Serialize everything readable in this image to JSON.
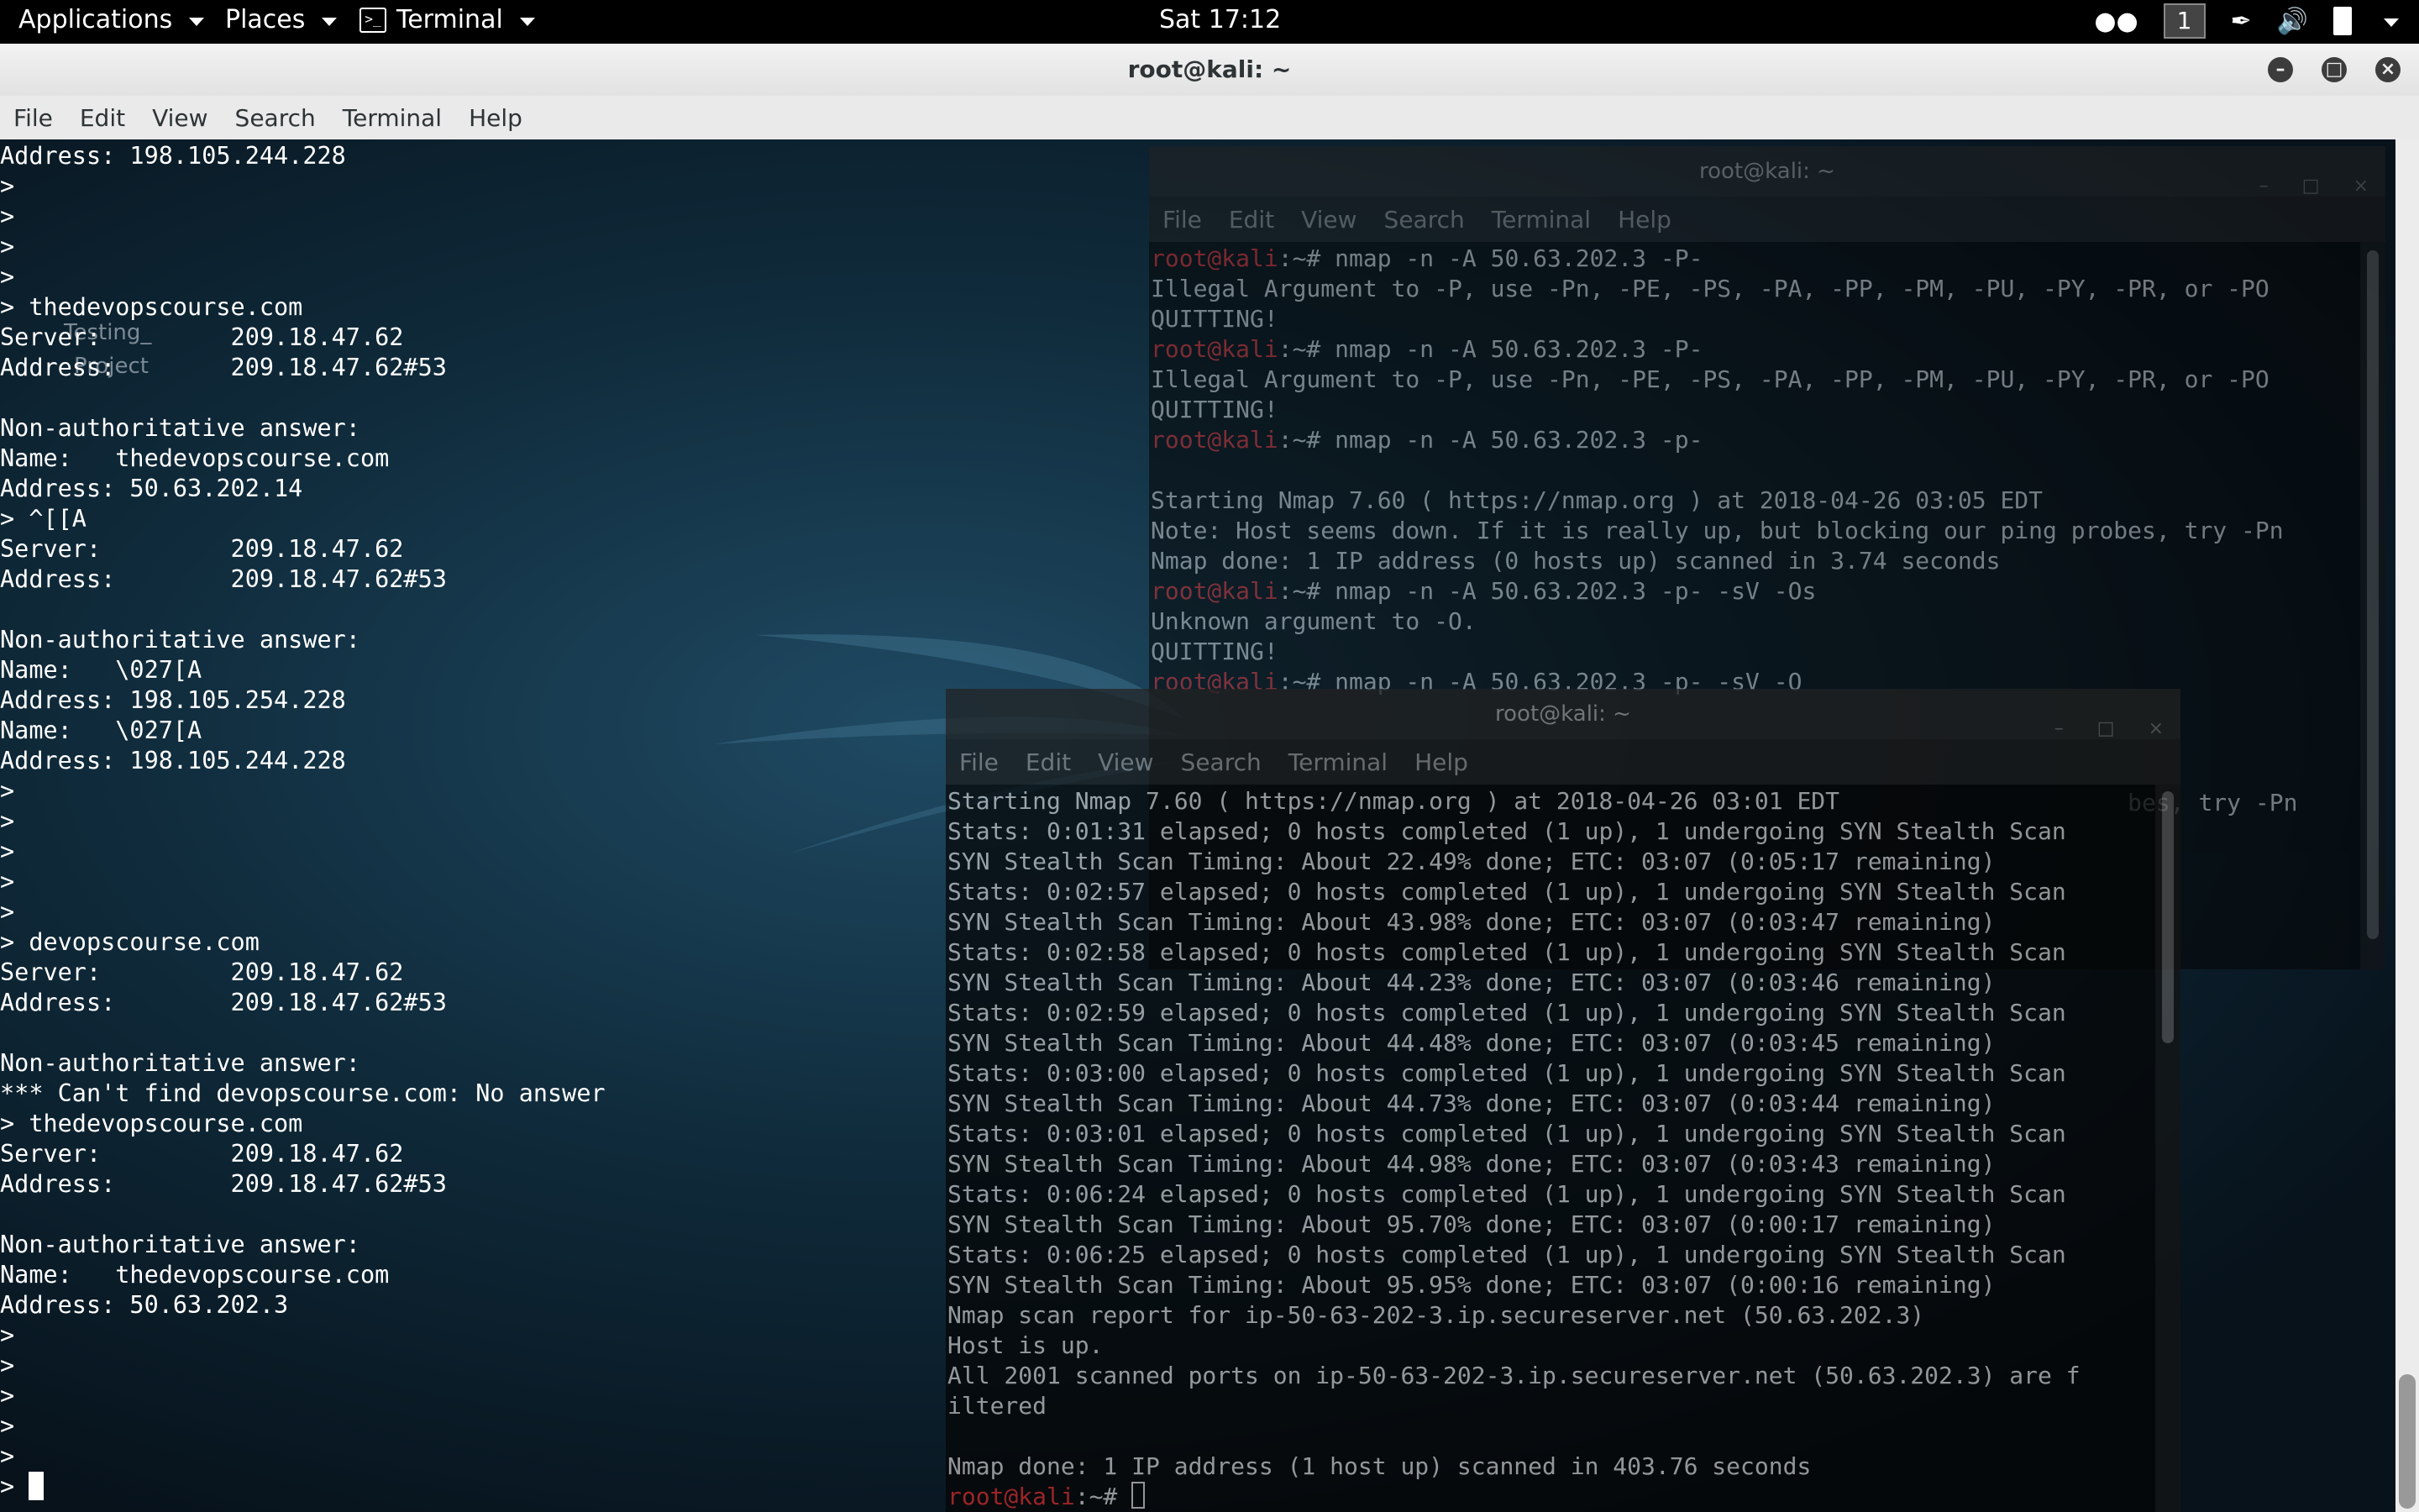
{
  "topbar": {
    "applications": "Applications",
    "places": "Places",
    "terminal": "Terminal",
    "clock": "Sat 17:12",
    "workspace": "1"
  },
  "main_window": {
    "title": "root@kali: ~",
    "menu": [
      "File",
      "Edit",
      "View",
      "Search",
      "Terminal",
      "Help"
    ],
    "ghost_icon_label": [
      "Testing_",
      "Project"
    ],
    "lines": [
      "Address: 198.105.244.228",
      ">",
      ">",
      ">",
      ">",
      "> thedevopscourse.com",
      "Server:\t\t209.18.47.62",
      "Address:\t209.18.47.62#53",
      "",
      "Non-authoritative answer:",
      "Name:\tthedevopscourse.com",
      "Address: 50.63.202.14",
      "> ^[[A",
      "Server:\t\t209.18.47.62",
      "Address:\t209.18.47.62#53",
      "",
      "Non-authoritative answer:",
      "Name:\t\\027[A",
      "Address: 198.105.254.228",
      "Name:\t\\027[A",
      "Address: 198.105.244.228",
      ">",
      ">",
      ">",
      ">",
      ">",
      "> devopscourse.com",
      "Server:\t\t209.18.47.62",
      "Address:\t209.18.47.62#53",
      "",
      "Non-authoritative answer:",
      "*** Can't find devopscourse.com: No answer",
      "> thedevopscourse.com",
      "Server:\t\t209.18.47.62",
      "Address:\t209.18.47.62#53",
      "",
      "Non-authoritative answer:",
      "Name:\tthedevopscourse.com",
      "Address: 50.63.202.3",
      ">",
      ">",
      ">",
      ">",
      ">",
      "> "
    ]
  },
  "bg_window": {
    "title": "root@kali: ~",
    "menu": [
      "File",
      "Edit",
      "View",
      "Search",
      "Terminal",
      "Help"
    ],
    "prompt": "root@kali",
    "lines": [
      {
        "p": true,
        "t": ":~# nmap -n -A 50.63.202.3 -P-"
      },
      {
        "p": false,
        "t": "Illegal Argument to -P, use -Pn, -PE, -PS, -PA, -PP, -PM, -PU, -PY, -PR, or -PO"
      },
      {
        "p": false,
        "t": "QUITTING!"
      },
      {
        "p": true,
        "t": ":~# nmap -n -A 50.63.202.3 -P-"
      },
      {
        "p": false,
        "t": "Illegal Argument to -P, use -Pn, -PE, -PS, -PA, -PP, -PM, -PU, -PY, -PR, or -PO"
      },
      {
        "p": false,
        "t": "QUITTING!"
      },
      {
        "p": true,
        "t": ":~# nmap -n -A 50.63.202.3 -p-"
      },
      {
        "p": false,
        "t": ""
      },
      {
        "p": false,
        "t": "Starting Nmap 7.60 ( https://nmap.org ) at 2018-04-26 03:05 EDT"
      },
      {
        "p": false,
        "t": "Note: Host seems down. If it is really up, but blocking our ping probes, try -Pn"
      },
      {
        "p": false,
        "t": "Nmap done: 1 IP address (0 hosts up) scanned in 3.74 seconds"
      },
      {
        "p": true,
        "t": ":~# nmap -n -A 50.63.202.3 -p- -sV -Os"
      },
      {
        "p": false,
        "t": "Unknown argument to -O."
      },
      {
        "p": false,
        "t": "QUITTING!"
      },
      {
        "p": true,
        "t": ":~# nmap -n -A 50.63.202.3 -p- -sV -O"
      },
      {
        "p": false,
        "t": ""
      },
      {
        "p": false,
        "t": ""
      },
      {
        "p": false,
        "t": ""
      },
      {
        "p": false,
        "t": "                                                                     bes, try -Pn"
      }
    ]
  },
  "fg_window": {
    "title": "root@kali: ~",
    "menu": [
      "File",
      "Edit",
      "View",
      "Search",
      "Terminal",
      "Help"
    ],
    "prompt": "root@kali",
    "prompt_tail": ":~# ",
    "lines": [
      "Starting Nmap 7.60 ( https://nmap.org ) at 2018-04-26 03:01 EDT",
      "Stats: 0:01:31 elapsed; 0 hosts completed (1 up), 1 undergoing SYN Stealth Scan",
      "SYN Stealth Scan Timing: About 22.49% done; ETC: 03:07 (0:05:17 remaining)",
      "Stats: 0:02:57 elapsed; 0 hosts completed (1 up), 1 undergoing SYN Stealth Scan",
      "SYN Stealth Scan Timing: About 43.98% done; ETC: 03:07 (0:03:47 remaining)",
      "Stats: 0:02:58 elapsed; 0 hosts completed (1 up), 1 undergoing SYN Stealth Scan",
      "SYN Stealth Scan Timing: About 44.23% done; ETC: 03:07 (0:03:46 remaining)",
      "Stats: 0:02:59 elapsed; 0 hosts completed (1 up), 1 undergoing SYN Stealth Scan",
      "SYN Stealth Scan Timing: About 44.48% done; ETC: 03:07 (0:03:45 remaining)",
      "Stats: 0:03:00 elapsed; 0 hosts completed (1 up), 1 undergoing SYN Stealth Scan",
      "SYN Stealth Scan Timing: About 44.73% done; ETC: 03:07 (0:03:44 remaining)",
      "Stats: 0:03:01 elapsed; 0 hosts completed (1 up), 1 undergoing SYN Stealth Scan",
      "SYN Stealth Scan Timing: About 44.98% done; ETC: 03:07 (0:03:43 remaining)",
      "Stats: 0:06:24 elapsed; 0 hosts completed (1 up), 1 undergoing SYN Stealth Scan",
      "SYN Stealth Scan Timing: About 95.70% done; ETC: 03:07 (0:00:17 remaining)",
      "Stats: 0:06:25 elapsed; 0 hosts completed (1 up), 1 undergoing SYN Stealth Scan",
      "SYN Stealth Scan Timing: About 95.95% done; ETC: 03:07 (0:00:16 remaining)",
      "Nmap scan report for ip-50-63-202-3.ip.secureserver.net (50.63.202.3)",
      "Host is up.",
      "All 2001 scanned ports on ip-50-63-202-3.ip.secureserver.net (50.63.202.3) are f",
      "iltered",
      "",
      "Nmap done: 1 IP address (1 host up) scanned in 403.76 seconds"
    ]
  },
  "colors": {
    "prompt_red": "#d32a2a",
    "terminal_text": "#ffffff",
    "topbar_bg": "#000000"
  }
}
